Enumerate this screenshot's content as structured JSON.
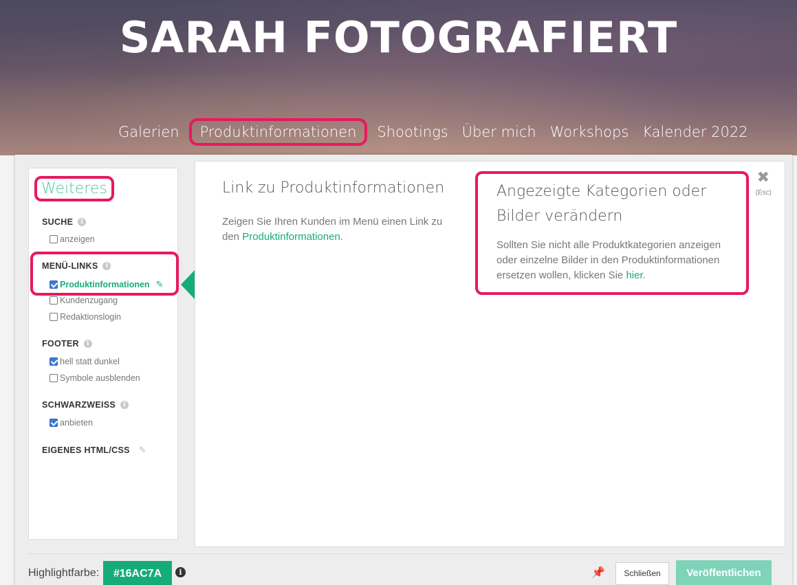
{
  "site": {
    "title": "SARAH FOTOGRAFIERT",
    "nav": [
      "Galerien",
      "Produktinformationen",
      "Shootings",
      "Über mich",
      "Workshops",
      "Kalender 2022"
    ]
  },
  "sidebar": {
    "title": "Weiteres",
    "sections": {
      "suche": {
        "label": "SUCHE",
        "options": [
          "anzeigen"
        ]
      },
      "menu_links": {
        "label": "MENÜ-LINKS",
        "options": [
          "Produktinformationen",
          "Kundenzugang",
          "Redaktionslogin"
        ]
      },
      "footer": {
        "label": "FOOTER",
        "options": [
          "hell statt dunkel",
          "Symbole ausblenden"
        ]
      },
      "schwarzweiss": {
        "label": "SCHWARZWEISS",
        "options": [
          "anbieten"
        ]
      },
      "html_css": {
        "label": "EIGENES HTML/CSS"
      }
    }
  },
  "main": {
    "col1_title": "Link zu Produktinformationen",
    "col1_text": "Zeigen Sie Ihren Kunden im Menü einen Link zu den ",
    "col1_link": "Produktinformationen",
    "col1_end": ".",
    "col2_title": "Angezeigte Kategorien oder Bilder verändern",
    "col2_text": "Sollten Sie nicht alle Produktkategorien anzeigen oder einzelne Bilder in den Produktinformationen ersetzen wollen, klicken Sie ",
    "col2_link": "hier",
    "col2_end": ".",
    "close_label": "✖",
    "esc_label": "(Esc)"
  },
  "footer_bar": {
    "highlight_label": "Highlightfarbe:",
    "highlight_value": "#16AC7A",
    "close_button": "Schließen",
    "publish_button": "Veröffentlichen"
  },
  "colors": {
    "accent": "#16ac7a",
    "highlight_frame": "#e8195c"
  }
}
